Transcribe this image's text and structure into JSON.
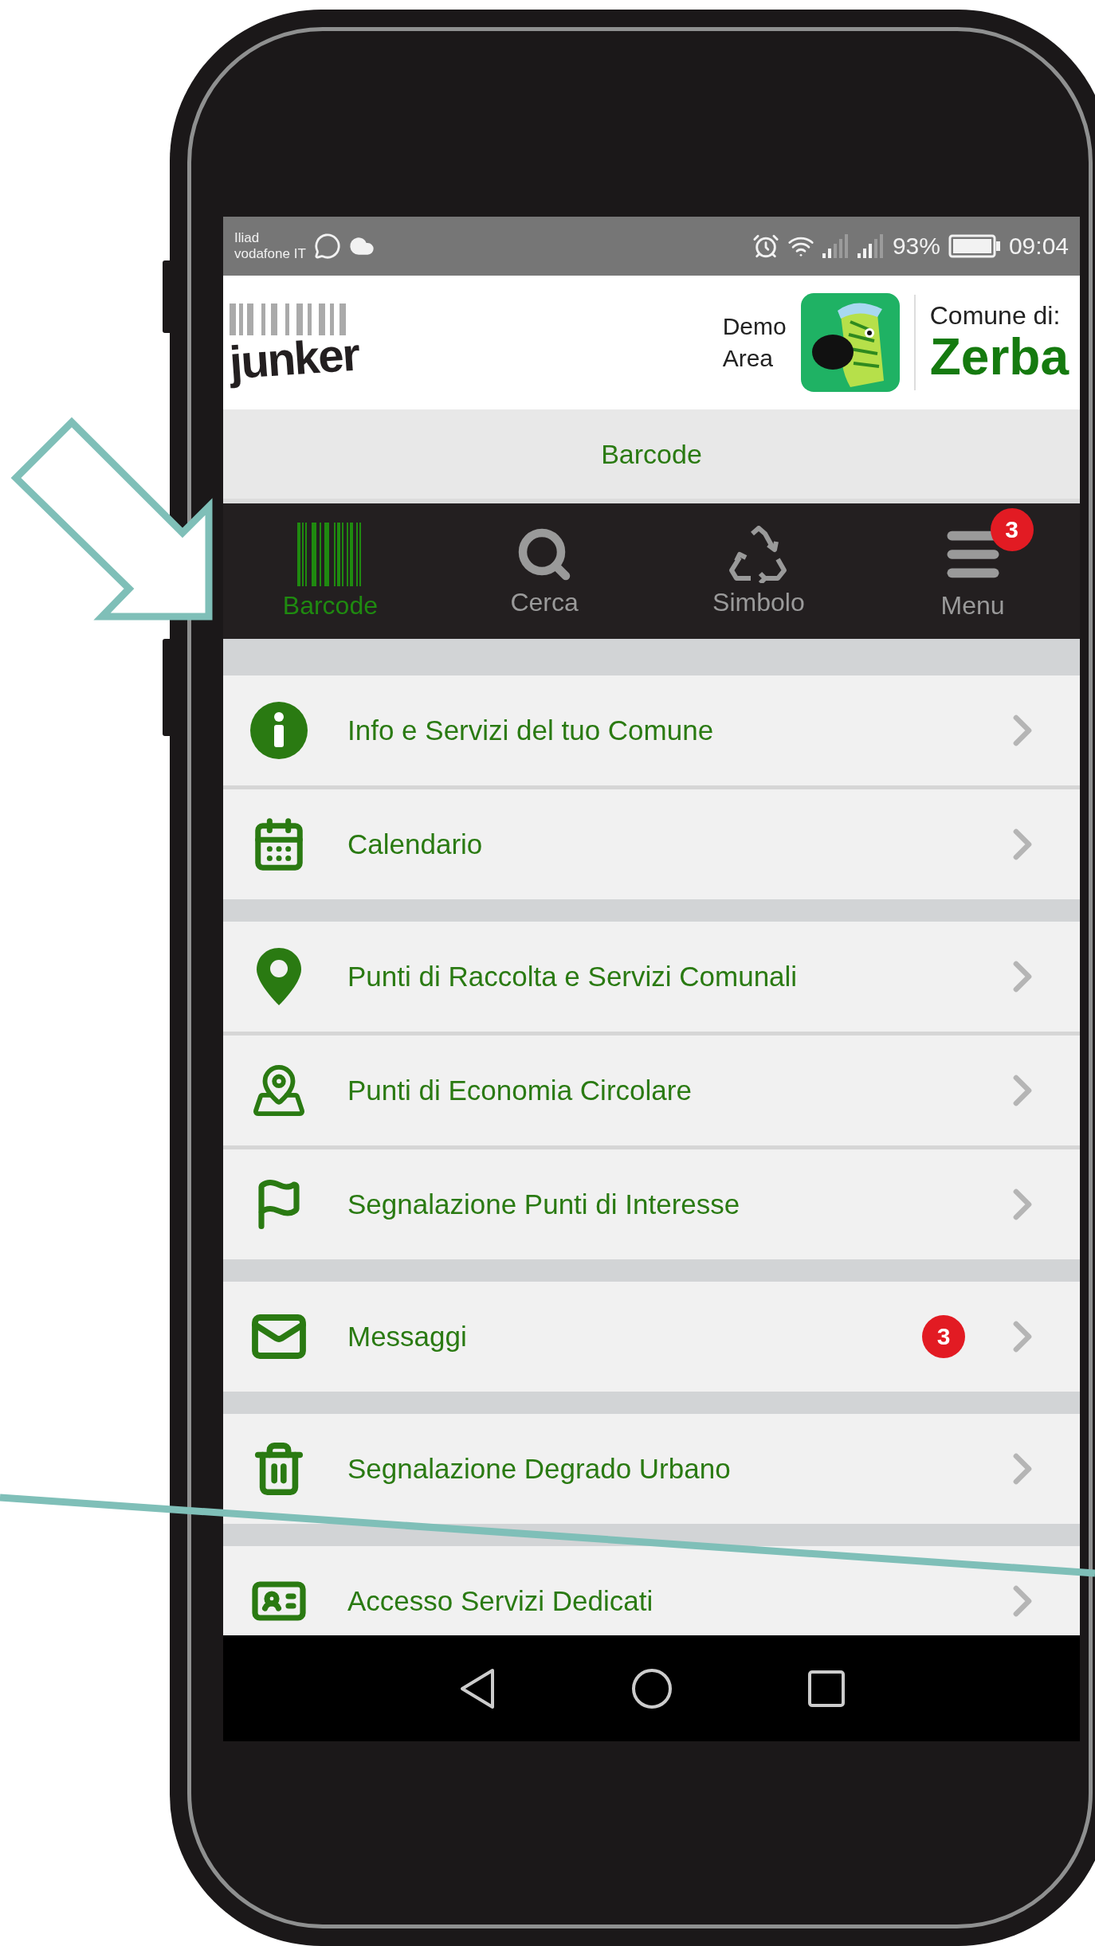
{
  "status_bar": {
    "carrier_1": "Iliad",
    "carrier_2": "vodafone IT",
    "battery": "93%",
    "time": "09:04"
  },
  "header": {
    "logo": "junker",
    "demo_label_1": "Demo",
    "demo_label_2": "Area",
    "municipality_label": "Comune di:",
    "municipality_name": "Zerba"
  },
  "title_bar": {
    "title": "Barcode"
  },
  "tabs": [
    {
      "label": "Barcode",
      "selected": true
    },
    {
      "label": "Cerca",
      "selected": false
    },
    {
      "label": "Simbolo",
      "selected": false
    },
    {
      "label": "Menu",
      "selected": false,
      "badge": "3"
    }
  ],
  "menu_groups": [
    {
      "items": [
        {
          "label": "Info e Servizi del tuo Comune"
        },
        {
          "label": "Calendario"
        }
      ]
    },
    {
      "items": [
        {
          "label": "Punti di Raccolta e Servizi Comunali"
        },
        {
          "label": "Punti di Economia Circolare"
        },
        {
          "label": "Segnalazione Punti di Interesse"
        }
      ]
    },
    {
      "items": [
        {
          "label": "Messaggi",
          "badge": "3"
        }
      ]
    },
    {
      "items": [
        {
          "label": "Segnalazione Degrado Urbano"
        }
      ]
    },
    {
      "items": [
        {
          "label": "Accesso Servizi Dedicati"
        }
      ]
    }
  ]
}
